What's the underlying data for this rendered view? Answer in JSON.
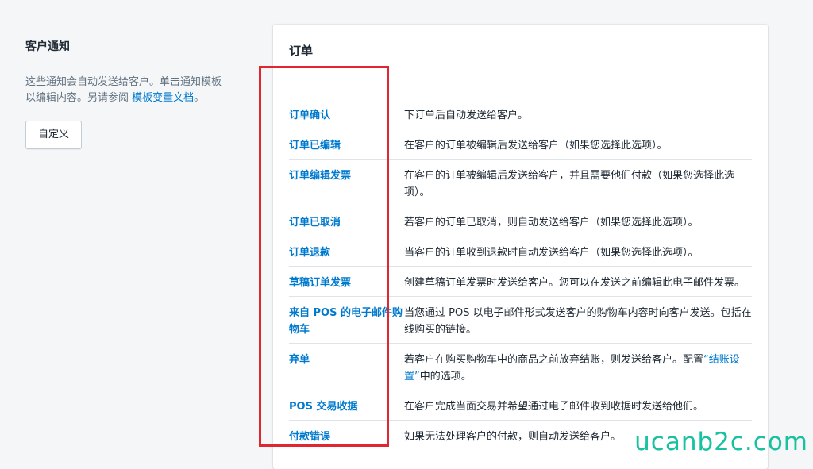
{
  "sidebar": {
    "title": "客户通知",
    "description_prefix": "这些通知会自动发送给客户。单击通知模板以编辑内容。另请参阅 ",
    "description_link": "模板变量文档",
    "description_suffix": "。",
    "customize_button": "自定义"
  },
  "card": {
    "title": "订单",
    "rows": [
      {
        "name": "订单确认",
        "desc": "下订单后自动发送给客户。"
      },
      {
        "name": "订单已编辑",
        "desc": "在客户的订单被编辑后发送给客户（如果您选择此选项）。"
      },
      {
        "name": "订单编辑发票",
        "desc": "在客户的订单被编辑后发送给客户，并且需要他们付款（如果您选择此选项）。"
      },
      {
        "name": "订单已取消",
        "desc": "若客户的订单已取消，则自动发送给客户（如果您选择此选项）。"
      },
      {
        "name": "订单退款",
        "desc": "当客户的订单收到退款时自动发送给客户（如果您选择此选项）。"
      },
      {
        "name": "草稿订单发票",
        "desc": "创建草稿订单发票时发送给客户。您可以在发送之前编辑此电子邮件发票。"
      },
      {
        "name": "来自 POS 的电子邮件购物车",
        "desc": "当您通过 POS 以电子邮件形式发送客户的购物车内容时向客户发送。包括在线购买的链接。"
      },
      {
        "name": "弃单",
        "desc_prefix": "若客户在购买购物车中的商品之前放弃结账，则发送给客户。配置",
        "desc_link": "“结账设置”",
        "desc_suffix": "中的选项。"
      },
      {
        "name": "POS 交易收据",
        "desc": "在客户完成当面交易并希望通过电子邮件收到收据时发送给他们。"
      },
      {
        "name": "付款错误",
        "desc": "如果无法处理客户的付款，则自动发送给客户。"
      }
    ]
  },
  "watermark": "ucanb2c.com",
  "colors": {
    "link": "#007ace",
    "highlight_border": "#e0262f",
    "watermark": "#18c2a0"
  }
}
